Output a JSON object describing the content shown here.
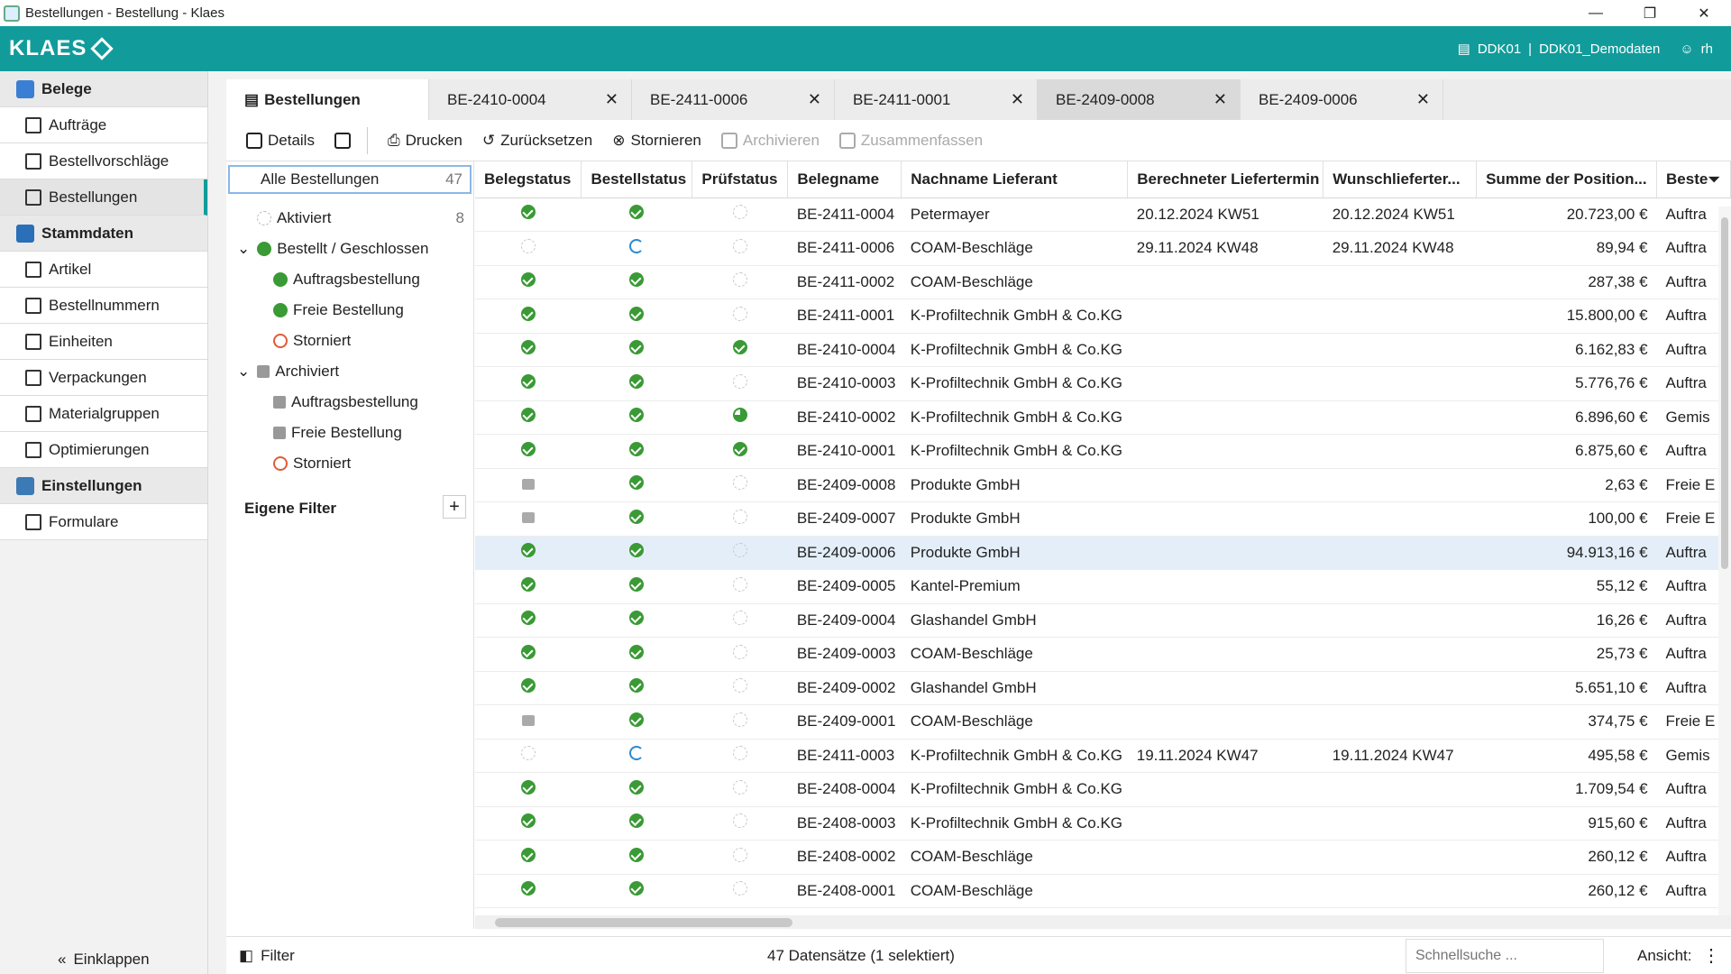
{
  "window": {
    "title": "Bestellungen - Bestellung - Klaes",
    "min": "—",
    "max": "❐",
    "close": "✕"
  },
  "appbar": {
    "logo": "KLAES",
    "db_code": "DDK01",
    "db_name": "DDK01_Demodaten",
    "user": "rh",
    "accent": "#119c9b"
  },
  "sidebar": {
    "groups": [
      {
        "label": "Belege",
        "color": "#3a7fd4",
        "items": [
          "Aufträge",
          "Bestellvorschläge",
          "Bestellungen"
        ]
      },
      {
        "label": "Stammdaten",
        "color": "#2a6fb8",
        "items": [
          "Artikel",
          "Bestellnummern",
          "Einheiten",
          "Verpackungen",
          "Materialgruppen",
          "Optimierungen"
        ]
      },
      {
        "label": "Einstellungen",
        "color": "#3c7ab5",
        "items": [
          "Formulare"
        ]
      }
    ],
    "collapse_label": "Einklappen"
  },
  "tabs": [
    {
      "label": "Bestellungen"
    },
    {
      "label": "BE-2410-0004",
      "close": "✕"
    },
    {
      "label": "BE-2411-0006",
      "close": "✕"
    },
    {
      "label": "BE-2411-0001",
      "close": "✕"
    },
    {
      "label": "BE-2409-0008",
      "close": "✕"
    },
    {
      "label": "BE-2409-0006",
      "close": "✕"
    }
  ],
  "toolbar": {
    "details": "Details",
    "drucken": "Drucken",
    "zuruecksetzen": "Zurücksetzen",
    "stornieren": "Stornieren",
    "archivieren": "Archivieren",
    "zusammenfassen": "Zusammenfassen"
  },
  "tree": {
    "all_label": "Alle Bestellungen",
    "all_count": "47",
    "aktiviert": "Aktiviert",
    "aktiviert_count": "8",
    "bestellt": "Bestellt / Geschlossen",
    "auftragsbestellung": "Auftragsbestellung",
    "freie": "Freie Bestellung",
    "storniert": "Storniert",
    "archiviert": "Archiviert",
    "a_auftragsbestellung": "Auftragsbestellung",
    "a_freie": "Freie Bestellung",
    "a_storniert": "Storniert",
    "eigene": "Eigene Filter",
    "plus": "+"
  },
  "table": {
    "headers": [
      "Belegstatus",
      "Bestellstatus",
      "Prüfstatus",
      "Belegname",
      "Nachname Lieferant",
      "Berechneter Liefertermin",
      "Wunschlieferter...",
      "Summe der Position...",
      "Beste"
    ],
    "rows": [
      {
        "bs": "green",
        "bst": "green",
        "ps": "empty",
        "name": "BE-2411-0004",
        "lief": "Petermayer",
        "ber": "20.12.2024 KW51",
        "wun": "20.12.2024 KW51",
        "sum": "20.723,00 €",
        "art": "Auftra"
      },
      {
        "bs": "empty",
        "bst": "sync",
        "ps": "empty",
        "name": "BE-2411-0006",
        "lief": "COAM-Beschläge",
        "ber": "29.11.2024 KW48",
        "wun": "29.11.2024 KW48",
        "sum": "89,94 €",
        "art": "Auftra"
      },
      {
        "bs": "green",
        "bst": "green",
        "ps": "empty",
        "name": "BE-2411-0002",
        "lief": "COAM-Beschläge",
        "ber": "",
        "wun": "",
        "sum": "287,38 €",
        "art": "Auftra"
      },
      {
        "bs": "green",
        "bst": "green",
        "ps": "empty",
        "name": "BE-2411-0001",
        "lief": "K-Profiltechnik GmbH & Co.KG",
        "ber": "",
        "wun": "",
        "sum": "15.800,00 €",
        "art": "Auftra"
      },
      {
        "bs": "green",
        "bst": "green",
        "ps": "green",
        "name": "BE-2410-0004",
        "lief": "K-Profiltechnik GmbH & Co.KG",
        "ber": "",
        "wun": "",
        "sum": "6.162,83 €",
        "art": "Auftra"
      },
      {
        "bs": "green",
        "bst": "green",
        "ps": "empty",
        "name": "BE-2410-0003",
        "lief": "K-Profiltechnik GmbH & Co.KG",
        "ber": "",
        "wun": "",
        "sum": "5.776,76 €",
        "art": "Auftra"
      },
      {
        "bs": "green",
        "bst": "green",
        "ps": "partial",
        "name": "BE-2410-0002",
        "lief": "K-Profiltechnik GmbH & Co.KG",
        "ber": "",
        "wun": "",
        "sum": "6.896,60 €",
        "art": "Gemis"
      },
      {
        "bs": "green",
        "bst": "green",
        "ps": "green",
        "name": "BE-2410-0001",
        "lief": "K-Profiltechnik GmbH & Co.KG",
        "ber": "",
        "wun": "",
        "sum": "6.875,60 €",
        "art": "Auftra"
      },
      {
        "bs": "arch",
        "bst": "green",
        "ps": "empty",
        "name": "BE-2409-0008",
        "lief": "Produkte GmbH",
        "ber": "",
        "wun": "",
        "sum": "2,63 €",
        "art": "Freie E"
      },
      {
        "bs": "arch",
        "bst": "green",
        "ps": "empty",
        "name": "BE-2409-0007",
        "lief": "Produkte GmbH",
        "ber": "",
        "wun": "",
        "sum": "100,00 €",
        "art": "Freie E"
      },
      {
        "bs": "green",
        "bst": "green",
        "ps": "empty",
        "name": "BE-2409-0006",
        "lief": "Produkte GmbH",
        "ber": "",
        "wun": "",
        "sum": "94.913,16 €",
        "art": "Auftra",
        "sel": true
      },
      {
        "bs": "green",
        "bst": "green",
        "ps": "empty",
        "name": "BE-2409-0005",
        "lief": "Kantel-Premium",
        "ber": "",
        "wun": "",
        "sum": "55,12 €",
        "art": "Auftra"
      },
      {
        "bs": "green",
        "bst": "green",
        "ps": "empty",
        "name": "BE-2409-0004",
        "lief": "Glashandel GmbH",
        "ber": "",
        "wun": "",
        "sum": "16,26 €",
        "art": "Auftra"
      },
      {
        "bs": "green",
        "bst": "green",
        "ps": "empty",
        "name": "BE-2409-0003",
        "lief": "COAM-Beschläge",
        "ber": "",
        "wun": "",
        "sum": "25,73 €",
        "art": "Auftra"
      },
      {
        "bs": "green",
        "bst": "green",
        "ps": "empty",
        "name": "BE-2409-0002",
        "lief": "Glashandel GmbH",
        "ber": "",
        "wun": "",
        "sum": "5.651,10 €",
        "art": "Auftra"
      },
      {
        "bs": "arch",
        "bst": "green",
        "ps": "empty",
        "name": "BE-2409-0001",
        "lief": "COAM-Beschläge",
        "ber": "",
        "wun": "",
        "sum": "374,75 €",
        "art": "Freie E"
      },
      {
        "bs": "empty",
        "bst": "sync",
        "ps": "empty",
        "name": "BE-2411-0003",
        "lief": "K-Profiltechnik GmbH & Co.KG",
        "ber": "19.11.2024 KW47",
        "wun": "19.11.2024 KW47",
        "sum": "495,58 €",
        "art": "Gemis"
      },
      {
        "bs": "green",
        "bst": "green",
        "ps": "empty",
        "name": "BE-2408-0004",
        "lief": "K-Profiltechnik GmbH & Co.KG",
        "ber": "",
        "wun": "",
        "sum": "1.709,54 €",
        "art": "Auftra"
      },
      {
        "bs": "green",
        "bst": "green",
        "ps": "empty",
        "name": "BE-2408-0003",
        "lief": "K-Profiltechnik GmbH & Co.KG",
        "ber": "",
        "wun": "",
        "sum": "915,60 €",
        "art": "Auftra"
      },
      {
        "bs": "green",
        "bst": "green",
        "ps": "empty",
        "name": "BE-2408-0002",
        "lief": "COAM-Beschläge",
        "ber": "",
        "wun": "",
        "sum": "260,12 €",
        "art": "Auftra"
      },
      {
        "bs": "green",
        "bst": "green",
        "ps": "empty",
        "name": "BE-2408-0001",
        "lief": "COAM-Beschläge",
        "ber": "",
        "wun": "",
        "sum": "260,12 €",
        "art": "Auftra"
      }
    ]
  },
  "statusbar": {
    "filter": "Filter",
    "count": "47 Datensätze (1 selektiert)",
    "search_placeholder": "Schnellsuche ...",
    "ansicht": "Ansicht:",
    "more": "⋮"
  }
}
